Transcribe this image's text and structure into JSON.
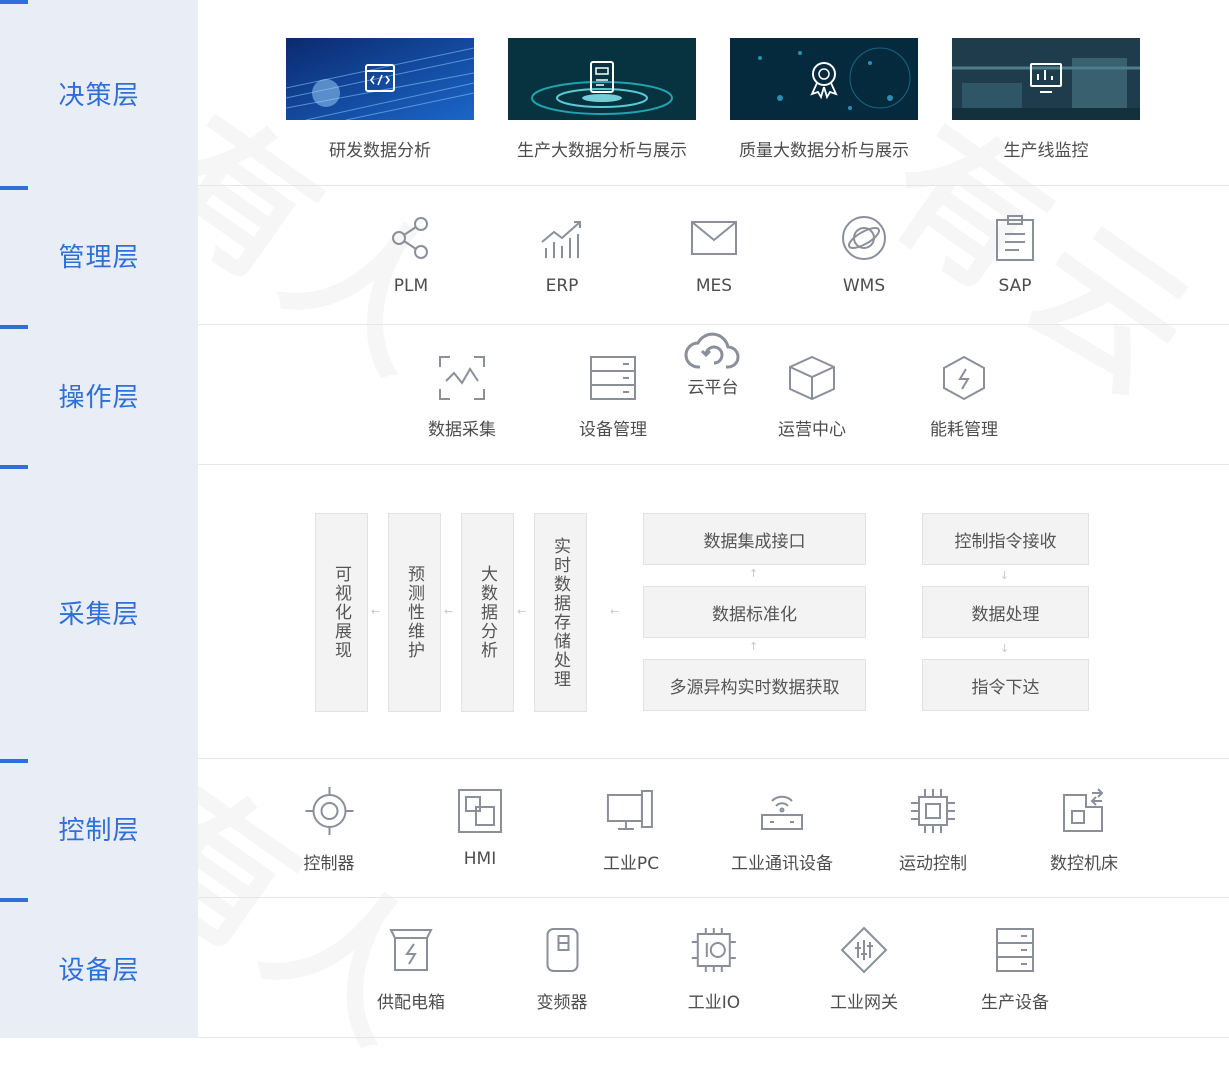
{
  "layers": [
    {
      "label": "决策层"
    },
    {
      "label": "管理层"
    },
    {
      "label": "操作层"
    },
    {
      "label": "采集层"
    },
    {
      "label": "控制层"
    },
    {
      "label": "设备层"
    }
  ],
  "decision": [
    {
      "label": "研发数据分析",
      "icon": "code-icon"
    },
    {
      "label": "生产大数据分析与展示",
      "icon": "document-icon"
    },
    {
      "label": "质量大数据分析与展示",
      "icon": "badge-icon"
    },
    {
      "label": "生产线监控",
      "icon": "monitor-icon"
    }
  ],
  "management": [
    {
      "label": "PLM",
      "icon": "share-icon"
    },
    {
      "label": "ERP",
      "icon": "trend-chart-icon"
    },
    {
      "label": "MES",
      "icon": "mail-icon"
    },
    {
      "label": "WMS",
      "icon": "planet-icon"
    },
    {
      "label": "SAP",
      "icon": "clipboard-icon"
    }
  ],
  "operation": {
    "cloud": "云平台",
    "items": [
      {
        "label": "数据采集",
        "icon": "scan-wave-icon"
      },
      {
        "label": "设备管理",
        "icon": "server-icon"
      },
      {
        "label": "运营中心",
        "icon": "cube-icon"
      },
      {
        "label": "能耗管理",
        "icon": "hexagon-bolt-icon"
      }
    ]
  },
  "collection": {
    "vertical": [
      "可视化展现",
      "预测性维护",
      "大数据分析",
      "实时数据存储处理"
    ],
    "middle": [
      "数据集成接口",
      "数据标准化",
      "多源异构实时数据获取"
    ],
    "right": [
      "控制指令接收",
      "数据处理",
      "指令下达"
    ]
  },
  "control": [
    {
      "label": "控制器",
      "icon": "controller-icon"
    },
    {
      "label": "HMI",
      "icon": "hmi-icon"
    },
    {
      "label": "工业PC",
      "icon": "pc-icon"
    },
    {
      "label": "工业通讯设备",
      "icon": "router-icon"
    },
    {
      "label": "运动控制",
      "icon": "chip-icon"
    },
    {
      "label": "数控机床",
      "icon": "cnc-icon"
    }
  ],
  "device": [
    {
      "label": "供配电箱",
      "icon": "power-box-icon"
    },
    {
      "label": "变频器",
      "icon": "inverter-icon"
    },
    {
      "label": "工业IO",
      "icon": "io-chip-icon"
    },
    {
      "label": "工业网关",
      "icon": "gateway-icon"
    },
    {
      "label": "生产设备",
      "icon": "equipment-icon"
    }
  ],
  "colors": {
    "accent": "#2e6fd8",
    "sidebar": "#e9eef6",
    "icon": "#8a8f99"
  }
}
